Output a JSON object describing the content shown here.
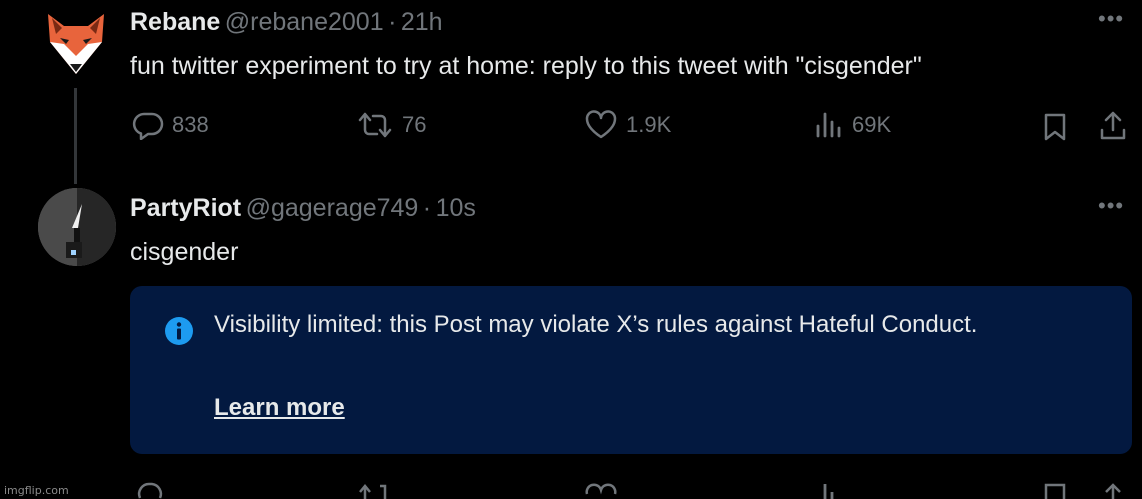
{
  "tweet1": {
    "display_name": "Rebane",
    "handle": "@rebane2001",
    "separator": "·",
    "time": "21h",
    "text": "fun twitter experiment to try at home: reply to this tweet with \"cisgender\"",
    "actions": {
      "replies": "838",
      "retweets": "76",
      "likes": "1.9K",
      "views": "69K"
    },
    "avatar_icon": "fox-icon",
    "more_icon": "more-icon"
  },
  "tweet2": {
    "display_name": "PartyRiot",
    "handle": "@gagerage749",
    "separator": "·",
    "time": "10s",
    "text": "cisgender",
    "avatar_icon": "user-avatar",
    "more_icon": "more-icon",
    "notice": {
      "icon": "info-icon",
      "text": "Visibility limited: this Post may violate X’s rules against Hateful Conduct.",
      "link": "Learn more"
    }
  },
  "icons": {
    "reply": "reply-icon",
    "retweet": "retweet-icon",
    "like": "heart-icon",
    "views": "views-icon",
    "bookmark": "bookmark-icon",
    "share": "share-icon"
  },
  "colors": {
    "background": "#000000",
    "text": "#e7e9ea",
    "muted": "#71767b",
    "notice_bg": "#031940",
    "info_blue": "#1d9bf0",
    "fox_orange": "#e8643c"
  },
  "watermark": "imgflip.com"
}
